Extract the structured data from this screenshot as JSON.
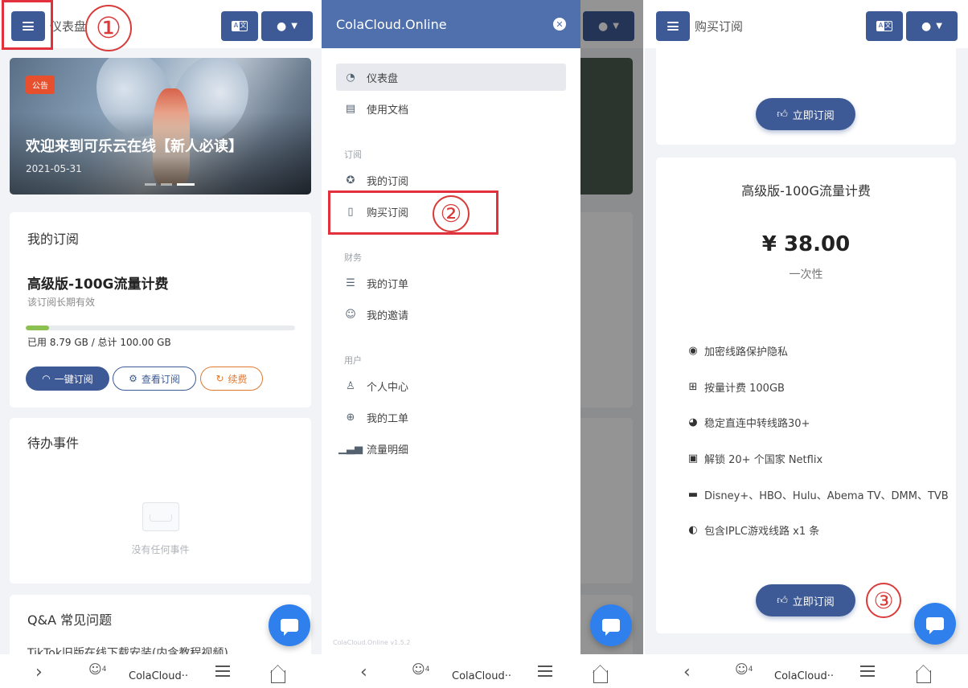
{
  "panel1": {
    "header_title": "仪表盘",
    "banner": {
      "tag": "公告",
      "title": "欢迎来到可乐云在线【新人必读】",
      "date": "2021-05-31"
    },
    "subscription": {
      "card_title": "我的订阅",
      "plan_name": "高级版-100G流量计费",
      "validity": "该订阅长期有效",
      "usage_text": "已用 8.79 GB / 总计 100.00 GB",
      "usage_fraction": 0.088,
      "buttons": {
        "one_click": "一键订阅",
        "view": "查看订阅",
        "renew": "续费"
      }
    },
    "todo": {
      "card_title": "待办事件",
      "empty_text": "没有任何事件"
    },
    "faq": {
      "card_title": "Q&A 常见问题",
      "first_item": "TikTok旧版在线下载安装(内含教程视频)"
    },
    "annotation": "①"
  },
  "panel2": {
    "brand": "ColaCloud.Online",
    "close_icon": "✕",
    "menu": [
      {
        "label": "仪表盘",
        "icon": "dashboard-icon",
        "active": true
      },
      {
        "label": "使用文档",
        "icon": "book-icon",
        "active": false
      }
    ],
    "sections": [
      {
        "title": "订阅",
        "items": [
          {
            "label": "我的订阅",
            "icon": "award-icon"
          },
          {
            "label": "购买订阅",
            "icon": "clipboard-icon"
          }
        ]
      },
      {
        "title": "财务",
        "items": [
          {
            "label": "我的订单",
            "icon": "list-icon"
          },
          {
            "label": "我的邀请",
            "icon": "invite-icon"
          }
        ]
      },
      {
        "title": "用户",
        "items": [
          {
            "label": "个人中心",
            "icon": "user-icon"
          },
          {
            "label": "我的工单",
            "icon": "support-icon"
          },
          {
            "label": "流量明细",
            "icon": "bar-chart-icon"
          }
        ]
      }
    ],
    "version": "ColaCloud.Online v1.5.2",
    "annotation": "②"
  },
  "panel3": {
    "header_title": "购买订阅",
    "plan": {
      "name": "高级版-100G流量计费",
      "price": "¥ 38.00",
      "period": "一次性",
      "features": [
        {
          "icon": "fingerprint-icon",
          "text": "加密线路保护隐私"
        },
        {
          "icon": "network-icon",
          "text": "按量计费 100GB"
        },
        {
          "icon": "speedometer-icon",
          "text": "稳定直连中转线路30+"
        },
        {
          "icon": "film-icon",
          "text": "解锁 20+ 个国家 Netflix"
        },
        {
          "icon": "tv-icon",
          "text": "Disney+、HBO、Hulu、Abema TV、DMM、TVB"
        },
        {
          "icon": "steam-icon",
          "text": "包含IPLC游戏线路 x1 条"
        }
      ],
      "subscribe_label": "立即订阅"
    },
    "top_subscribe_label": "立即订阅",
    "annotation": "③"
  },
  "navbar": {
    "title": "ColaCloud··",
    "tabs_count": "4"
  },
  "colors": {
    "primary": "#3d5a96",
    "drawer_header": "#4f6fad",
    "annotation_red": "#e0313c",
    "fab_blue": "#2f80ed",
    "progress_green": "#8cc152",
    "renew_orange": "#e0782f"
  }
}
